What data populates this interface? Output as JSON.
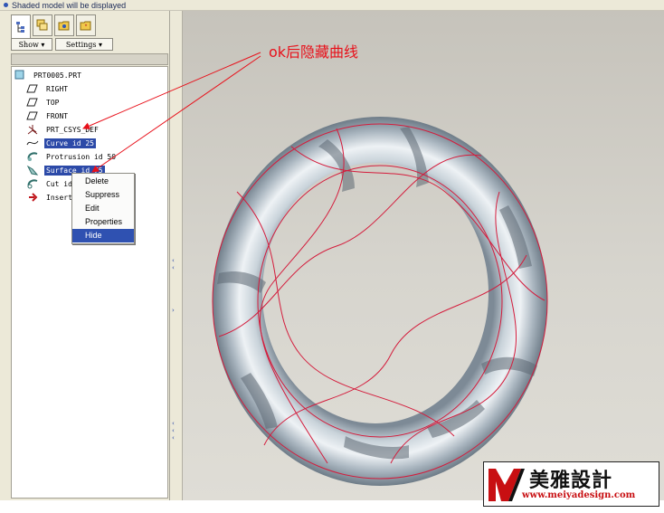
{
  "status": {
    "message": "Shaded model will be displayed"
  },
  "tabs": [
    {
      "name": "model-tree",
      "icon": "tree-icon"
    },
    {
      "name": "layers",
      "icon": "layers-icon"
    },
    {
      "name": "folder",
      "icon": "folder-icon"
    },
    {
      "name": "favorites",
      "icon": "favorites-icon"
    }
  ],
  "menu": {
    "show": "Show ▾",
    "settings": "Settings ▾"
  },
  "tree": {
    "root": "PRT0005.PRT",
    "items": [
      {
        "label": "RIGHT",
        "icon": "datum-plane-icon",
        "selected": false
      },
      {
        "label": "TOP",
        "icon": "datum-plane-icon",
        "selected": false
      },
      {
        "label": "FRONT",
        "icon": "datum-plane-icon",
        "selected": false
      },
      {
        "label": "PRT_CSYS_DEF",
        "icon": "csys-icon",
        "selected": false
      },
      {
        "label": "Curve id 25",
        "icon": "curve-icon",
        "selected": true
      },
      {
        "label": "Protrusion id 50",
        "icon": "protrusion-icon",
        "selected": false
      },
      {
        "label": "Surface id 75",
        "icon": "surface-icon",
        "selected": true
      },
      {
        "label": "Cut id",
        "icon": "cut-icon",
        "selected": false
      },
      {
        "label": "Insert",
        "icon": "insert-here-icon",
        "selected": false
      }
    ]
  },
  "context_menu": {
    "items": [
      "Delete",
      "Suppress",
      "Edit",
      "Properties",
      "Hide"
    ],
    "highlighted": "Hide"
  },
  "annotation": {
    "text": "ok后隐藏曲线",
    "color": "#e8101a"
  },
  "watermark": {
    "cn": "美雅設計",
    "url": "www.meiyadesign.com"
  },
  "colors": {
    "panel": "#ece9d8",
    "selection": "#2c4aa8",
    "model": "#b7c3cc",
    "curve": "#d41c3c"
  }
}
